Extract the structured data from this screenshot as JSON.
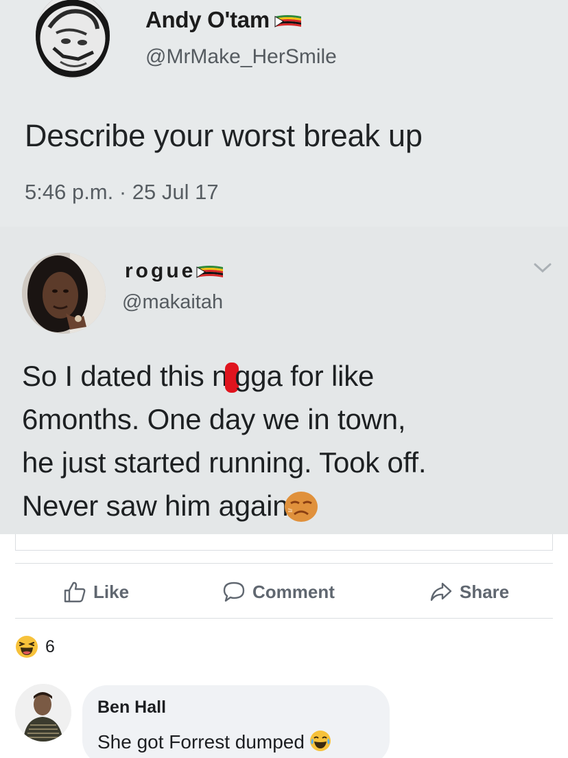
{
  "tweets": [
    {
      "display_name": "Andy O'tam",
      "handle": "@MrMake_HerSmile",
      "text": "Describe your worst break up",
      "timestamp": "5:46 p.m. · 25 Jul 17",
      "avatar_icon": "avatar-sketch-icon",
      "flag_icon": "zimbabwe-flag-icon"
    },
    {
      "display_name": "rogue",
      "handle": "@makaitah",
      "text_line1_a": "So I dated this n",
      "text_line1_b": "gga for like",
      "text_line2": "6months. One day we in town,",
      "text_line3": "he just started running. Took off.",
      "text_line4": "Never saw him again",
      "avatar_icon": "avatar-photo-icon",
      "flag_icon": "zimbabwe-flag-icon",
      "menu_icon": "chevron-down-icon",
      "emoji": "disappointed-face-emoji"
    }
  ],
  "actions": {
    "like_label": "Like",
    "comment_label": "Comment",
    "share_label": "Share"
  },
  "reactions": {
    "icon": "haha-reaction-icon",
    "count": "6"
  },
  "comment": {
    "author": "Ben Hall",
    "text": "She got Forrest dumped",
    "emoji": "tears-of-joy-emoji"
  },
  "colors": {
    "redaction": "#e0141e",
    "action_text": "#606770",
    "comment_bubble": "#f0f2f5",
    "tweet_background": "#e6e9ea"
  }
}
